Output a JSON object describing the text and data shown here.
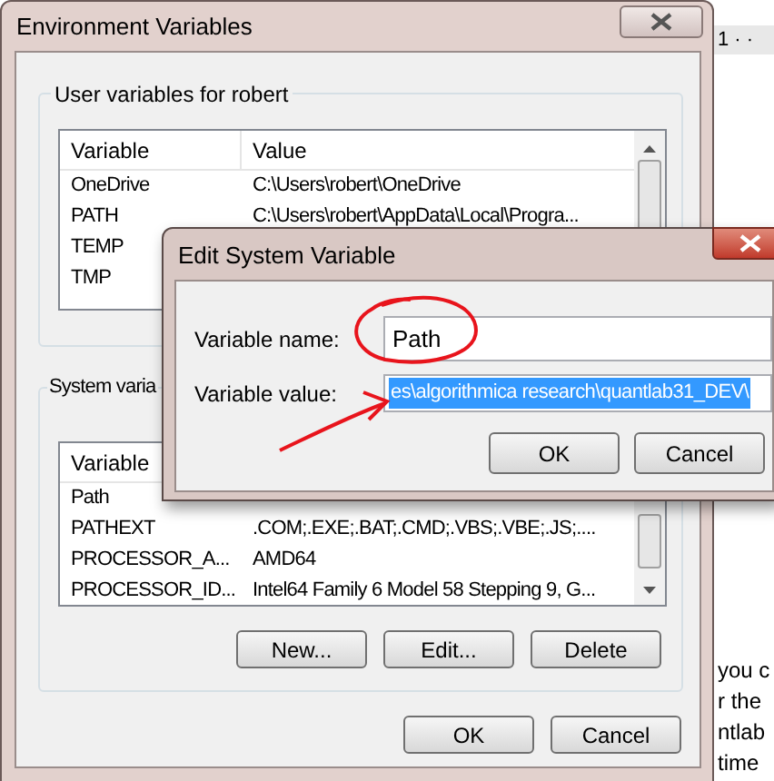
{
  "environment_window": {
    "title": "Environment Variables",
    "user_group": {
      "label": "User variables for robert",
      "columns": [
        "Variable",
        "Value"
      ],
      "rows": [
        {
          "variable": "OneDrive",
          "value": "C:\\Users\\robert\\OneDrive"
        },
        {
          "variable": "PATH",
          "value": "C:\\Users\\robert\\AppData\\Local\\Progra..."
        },
        {
          "variable": "TEMP"
        },
        {
          "variable": "TMP"
        }
      ]
    },
    "system_group": {
      "label": "System varia",
      "columns": [
        "Variable"
      ],
      "rows": [
        {
          "variable": "Path"
        },
        {
          "variable": "PATHEXT",
          "value": ".COM;.EXE;.BAT;.CMD;.VBS;.VBE;.JS;...."
        },
        {
          "variable": "PROCESSOR_A...",
          "value": "AMD64"
        },
        {
          "variable": "PROCESSOR_ID...",
          "value": "Intel64 Family 6 Model 58 Stepping 9, G..."
        }
      ]
    },
    "list_buttons": [
      "New...",
      "Edit...",
      "Delete"
    ],
    "footer_buttons": [
      "OK",
      "Cancel"
    ]
  },
  "edit_dialog": {
    "title": "Edit System Variable",
    "name_label": "Variable name:",
    "name_value": "Path",
    "value_label": "Variable value:",
    "value_value": "es\\algorithmica research\\quantlab31_DEV\\",
    "value_selected": true,
    "buttons": [
      "OK",
      "Cancel"
    ]
  },
  "background_document": {
    "ruler": "1 · ·",
    "lines": [
      "you c",
      "r the",
      "ntlab",
      "time"
    ]
  }
}
